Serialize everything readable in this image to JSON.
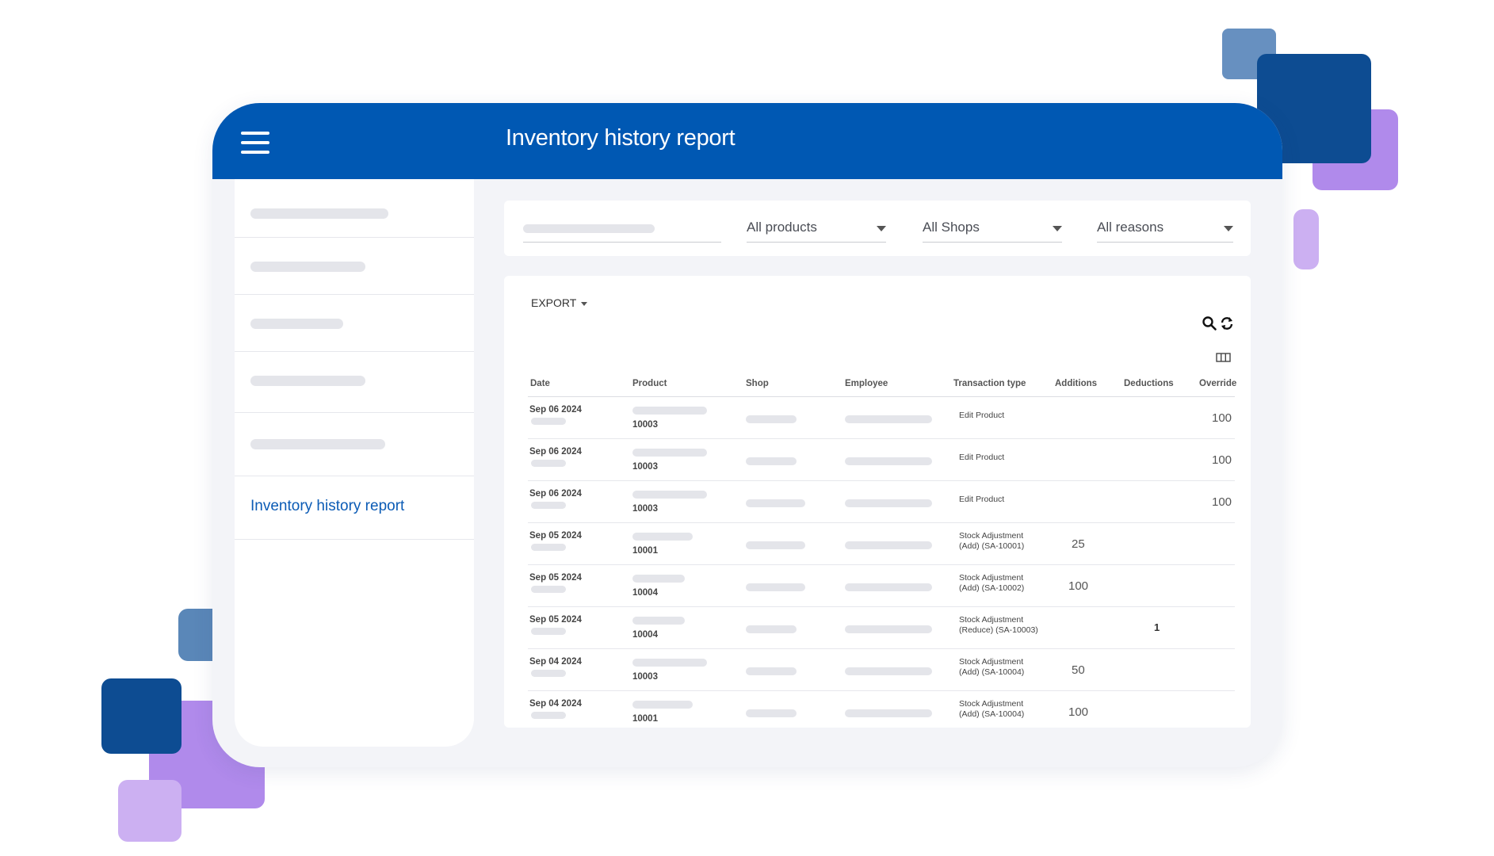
{
  "app": {
    "title": "Inventory history report"
  },
  "sidebar": {
    "active_label": "Inventory history report"
  },
  "filters": {
    "products": "All products",
    "shops": "All Shops",
    "reasons": "All reasons"
  },
  "toolbar": {
    "export_label": "EXPORT"
  },
  "table": {
    "headers": [
      "Date",
      "Product",
      "Shop",
      "Employee",
      "Transaction type",
      "Additions",
      "Deductions",
      "Override"
    ],
    "rows": [
      {
        "date": "Sep 06 2024",
        "product": "10003",
        "tx1": "Edit Product",
        "tx2": "",
        "additions": "",
        "deductions": "",
        "override": "100"
      },
      {
        "date": "Sep 06 2024",
        "product": "10003",
        "tx1": "Edit Product",
        "tx2": "",
        "additions": "",
        "deductions": "",
        "override": "100"
      },
      {
        "date": "Sep 06 2024",
        "product": "10003",
        "tx1": "Edit Product",
        "tx2": "",
        "additions": "",
        "deductions": "",
        "override": "100"
      },
      {
        "date": "Sep 05 2024",
        "product": "10001",
        "tx1": "Stock Adjustment",
        "tx2": "(Add) (SA-10001)",
        "additions": "25",
        "deductions": "",
        "override": ""
      },
      {
        "date": "Sep 05 2024",
        "product": "10004",
        "tx1": "Stock Adjustment",
        "tx2": "(Add) (SA-10002)",
        "additions": "100",
        "deductions": "",
        "override": ""
      },
      {
        "date": "Sep 05 2024",
        "product": "10004",
        "tx1": "Stock Adjustment",
        "tx2": "(Reduce) (SA-10003)",
        "additions": "",
        "deductions": "1",
        "override": ""
      },
      {
        "date": "Sep 04 2024",
        "product": "10003",
        "tx1": "Stock Adjustment",
        "tx2": "(Add) (SA-10004)",
        "additions": "50",
        "deductions": "",
        "override": ""
      },
      {
        "date": "Sep 04 2024",
        "product": "10001",
        "tx1": "Stock Adjustment",
        "tx2": "(Add) (SA-10004)",
        "additions": "100",
        "deductions": "",
        "override": ""
      }
    ]
  },
  "colors": {
    "brand": "#0058b3",
    "active_link": "#0b5bb5",
    "accent_purple": "#b08aeb",
    "accent_navy": "#0d4c92",
    "accent_steel": "#5a87b8"
  },
  "icons": [
    "menu-icon",
    "search-icon",
    "refresh-icon",
    "columns-icon",
    "chevron-down-icon"
  ]
}
